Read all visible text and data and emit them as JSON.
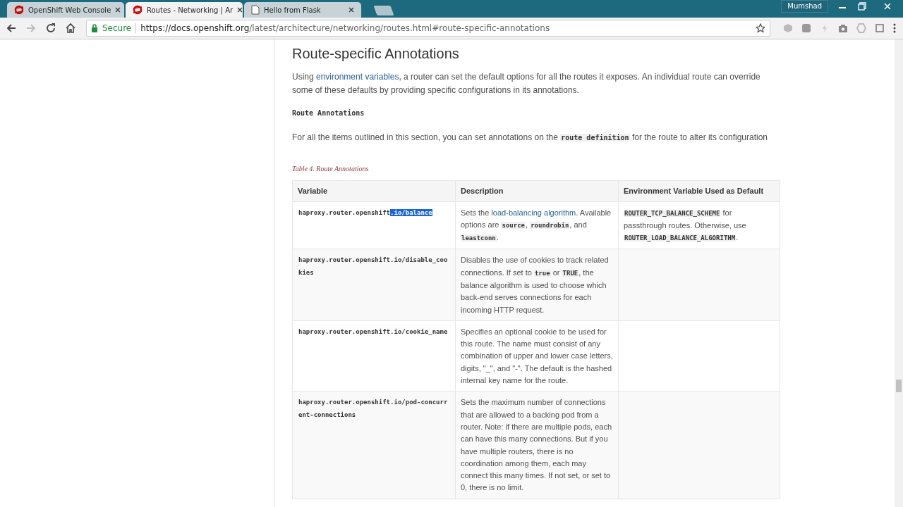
{
  "browser": {
    "tabs": [
      {
        "title": "OpenShift Web Console",
        "kind": "site",
        "selected": false
      },
      {
        "title": "Routes - Networking | Ar",
        "kind": "site",
        "selected": true
      },
      {
        "title": "Hello from Flask",
        "kind": "page",
        "selected": false
      }
    ],
    "user": "Mumshad",
    "secure_label": "Secure",
    "url_host": "https://docs.openshift.org",
    "url_path": "/latest/architecture/networking/routes.html#route-specific-annotations"
  },
  "page": {
    "heading": "Route-specific Annotations",
    "intro": [
      {
        "link": "environment variables"
      },
      {
        "text": ", a router can set the default options for all the routes it exposes. An individual route can override some of these defaults by providing specific configurations in its annotations."
      }
    ],
    "intro_prefix": "Using ",
    "subheading": "Route Annotations",
    "para": [
      {
        "text": "For all the items outlined in this section, you can set annotations on the "
      },
      {
        "code": "route definition"
      },
      {
        "text": " for the route to alter its configuration"
      }
    ],
    "table_caption": "Table 4. Route Annotations",
    "table": {
      "columns": [
        "Variable",
        "Description",
        "Environment Variable Used as Default"
      ],
      "rows": [
        {
          "variable": "haproxy.router.openshift",
          "selection": ".io/balance",
          "description": [
            {
              "text": "Sets the "
            },
            {
              "link": "load-balancing algorithm"
            },
            {
              "text": ". Available options are "
            },
            {
              "code": "source"
            },
            {
              "text": ", "
            },
            {
              "code": "roundrobin"
            },
            {
              "text": ", and "
            },
            {
              "code": "leastconn"
            },
            {
              "text": "."
            }
          ],
          "default": [
            {
              "code": "ROUTER_TCP_BALANCE_SCHEME"
            },
            {
              "text": " for passthrough routes. Otherwise, use "
            },
            {
              "code": "ROUTER_LOAD_BALANCE_ALGORITHM"
            },
            {
              "text": "."
            }
          ]
        },
        {
          "variable": "haproxy.router.openshift.io/disable_cookies",
          "description": [
            {
              "text": "Disables the use of cookies to track related connections. If set to "
            },
            {
              "code": "true"
            },
            {
              "text": " or "
            },
            {
              "code": "TRUE"
            },
            {
              "text": ", the balance algorithm is used to choose which back-end serves connections for each incoming HTTP request."
            }
          ]
        },
        {
          "variable": "haproxy.router.openshift.io/cookie_name",
          "description": [
            {
              "text": "Specifies an optional cookie to be used for this route. The name must consist of any combination of upper and lower case letters, digits, \"_\", and \"-\". The default is the hashed internal key name for the route."
            }
          ]
        },
        {
          "variable": "haproxy.router.openshift.io/pod-concurrent-connections",
          "description": [
            {
              "text": "Sets the maximum number of connections that are allowed to a backing pod from a router. Note: if there are multiple pods, each can have this many connections. But if you have multiple routers, there is no coordination among them, each may connect this many times. If not set, or set to 0, there is no limit."
            }
          ]
        }
      ]
    }
  }
}
